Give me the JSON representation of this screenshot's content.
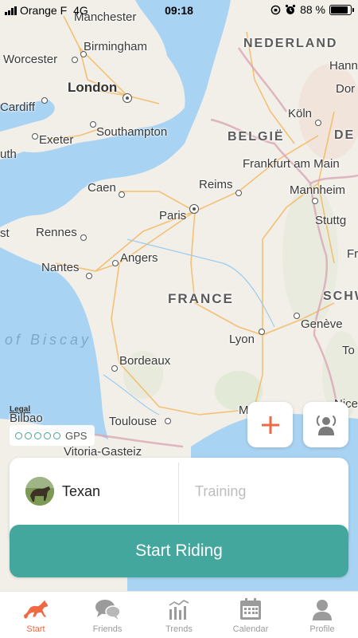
{
  "status_bar": {
    "carrier": "Orange F",
    "network": "4G",
    "time": "09:18",
    "battery": "88 %",
    "battery_level": 0.88
  },
  "map": {
    "legal_label": "Legal",
    "labels": {
      "manchester": "Manchester",
      "birmingham": "Birmingham",
      "worcester": "Worcester",
      "london": "London",
      "cardiff": "Cardiff",
      "exeter": "Exeter",
      "southampton": "Southampton",
      "uth": "uth",
      "nederland": "NEDERLAND",
      "hann": "Hann",
      "dor": "Dor",
      "koln": "Köln",
      "belgie": "BELGIË",
      "de": "DE",
      "frankfurt": "Frankfurt am Main",
      "mannheim": "Mannheim",
      "caen": "Caen",
      "reims": "Reims",
      "paris": "Paris",
      "stuttg": "Stuttg",
      "st": "st",
      "rennes": "Rennes",
      "angers": "Angers",
      "fr": "Fr",
      "nantes": "Nantes",
      "schw": "SCHW",
      "france": "FRANCE",
      "geneve": "Genève",
      "biscay": "of Biscay",
      "lyon": "Lyon",
      "to": "To",
      "bordeaux": "Bordeaux",
      "nice": "Nice",
      "bilbao": "Bilbao",
      "toulouse": "Toulouse",
      "marseille": "M",
      "vitoria": "Vitoria-Gasteiz"
    }
  },
  "controls": {
    "gps_label": "GPS",
    "add_icon": "plus-icon",
    "live_icon": "live-tracking-icon"
  },
  "ride_panel": {
    "horse_name": "Texan",
    "training_placeholder": "Training",
    "start_button": "Start Riding"
  },
  "tabs": [
    {
      "label": "Start",
      "icon": "horse-icon",
      "active": true
    },
    {
      "label": "Friends",
      "icon": "chat-bubbles-icon",
      "active": false
    },
    {
      "label": "Trends",
      "icon": "bar-chart-icon",
      "active": false
    },
    {
      "label": "Calendar",
      "icon": "calendar-icon",
      "active": false
    },
    {
      "label": "Profile",
      "icon": "person-icon",
      "active": false
    }
  ],
  "colors": {
    "accent": "#44a79d",
    "active_tab": "#ef6a43",
    "add_icon": "#ef6a43",
    "water": "#a9d3f2",
    "land": "#f2efe9"
  }
}
